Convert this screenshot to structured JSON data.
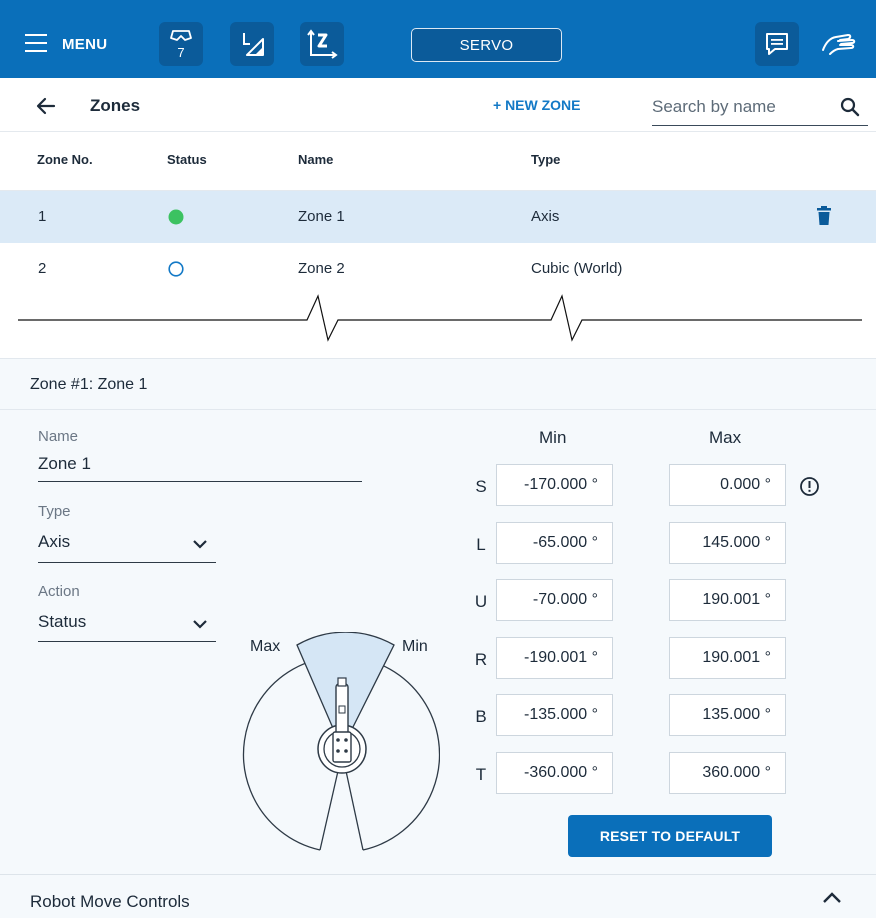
{
  "topbar": {
    "menu_label": "MENU",
    "tool_badge": "7",
    "servo_label": "SERVO"
  },
  "header": {
    "title": "Zones",
    "new_zone_label": "+ NEW ZONE",
    "search_placeholder": "Search by name"
  },
  "table": {
    "columns": [
      "Zone No.",
      "Status",
      "Name",
      "Type"
    ],
    "rows": [
      {
        "no": "1",
        "status": "active",
        "name": "Zone 1",
        "type": "Axis"
      },
      {
        "no": "2",
        "status": "inactive",
        "name": "Zone 2",
        "type": "Cubic (World)"
      }
    ]
  },
  "detail": {
    "title": "Zone #1: Zone 1",
    "name_label": "Name",
    "name_value": "Zone 1",
    "type_label": "Type",
    "type_value": "Axis",
    "action_label": "Action",
    "action_value": "Status",
    "diagram_max_label": "Max",
    "diagram_min_label": "Min",
    "min_header": "Min",
    "max_header": "Max",
    "joints": [
      {
        "label": "S",
        "min": "-170.000 °",
        "max": "0.000 °",
        "warning": true
      },
      {
        "label": "L",
        "min": "-65.000 °",
        "max": "145.000 °",
        "warning": false
      },
      {
        "label": "U",
        "min": "-70.000 °",
        "max": "190.001 °",
        "warning": false
      },
      {
        "label": "R",
        "min": "-190.001 °",
        "max": "190.001 °",
        "warning": false
      },
      {
        "label": "B",
        "min": "-135.000 °",
        "max": "135.000 °",
        "warning": false
      },
      {
        "label": "T",
        "min": "-360.000 °",
        "max": "360.000 °",
        "warning": false
      }
    ],
    "reset_label": "RESET TO DEFAULT"
  },
  "bottom": {
    "robot_move_controls_label": "Robot Move Controls"
  },
  "colors": {
    "brand_blue": "#0a6fba",
    "dark_blue": "#0b5b9a",
    "selected_row": "#dbeaf7",
    "status_active": "#3cc261",
    "status_inactive": "#1379c6"
  },
  "icons": [
    "menu-icon",
    "tool-icon",
    "frame-icon",
    "coordinate-icon",
    "chat-icon",
    "hand-icon",
    "back-arrow-icon",
    "search-icon",
    "trash-icon",
    "chevron-down-icon",
    "warning-icon",
    "chevron-up-icon"
  ]
}
